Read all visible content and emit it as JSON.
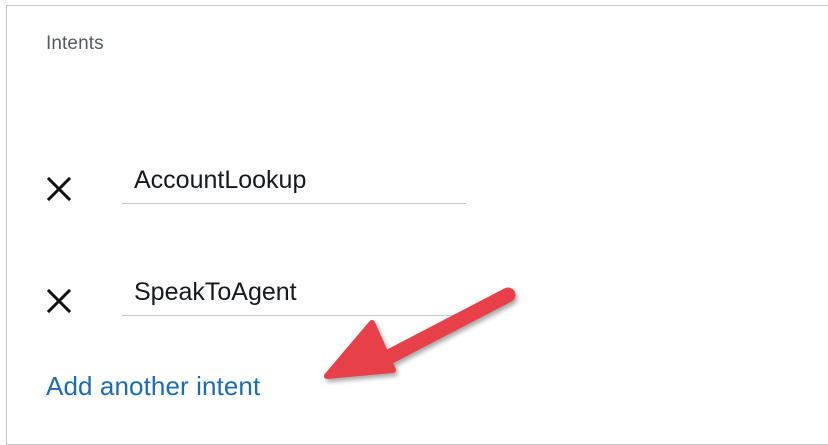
{
  "intents_panel": {
    "label": "Intents",
    "intents": [
      {
        "value": "AccountLookup",
        "remove_icon": "close-icon"
      },
      {
        "value": "SpeakToAgent",
        "remove_icon": "close-icon"
      }
    ],
    "add_link_label": "Add another intent"
  },
  "annotation": {
    "arrow_color": "#e8404a",
    "arrow_icon": "red-arrow"
  },
  "colors": {
    "label_text": "#545b64",
    "field_text": "#16191f",
    "link": "#1b6db1",
    "border": "#c6c6c6"
  }
}
